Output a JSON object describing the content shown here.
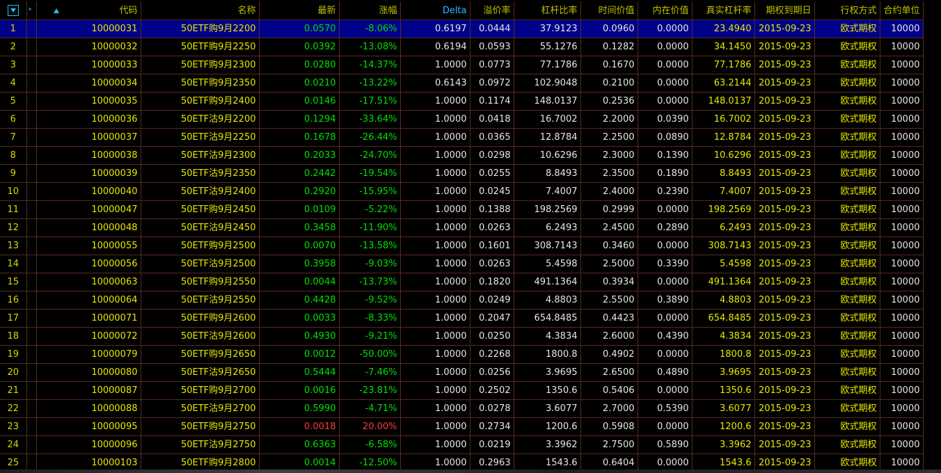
{
  "header": {
    "star": "*",
    "columns": [
      "代码",
      "名称",
      "最新",
      "涨幅",
      "Delta",
      "溢价率",
      "杠杆比率",
      "时间价值",
      "内在价值",
      "真实杠杆率",
      "期权到期日",
      "行权方式",
      "合约单位"
    ]
  },
  "rows": [
    {
      "no": "1",
      "code": "10000031",
      "name": "50ETF购9月2200",
      "last": "0.0570",
      "chg": "-8.06%",
      "delta": "0.6197",
      "prem": "0.0444",
      "lev": "37.9123",
      "tv": "0.0960",
      "iv": "0.0000",
      "real": "23.4940",
      "exp": "2015-09-23",
      "style": "欧式期权",
      "unit": "10000",
      "selected": true
    },
    {
      "no": "2",
      "code": "10000032",
      "name": "50ETF购9月2250",
      "last": "0.0392",
      "chg": "-13.08%",
      "delta": "0.6194",
      "prem": "0.0593",
      "lev": "55.1276",
      "tv": "0.1282",
      "iv": "0.0000",
      "real": "34.1450",
      "exp": "2015-09-23",
      "style": "欧式期权",
      "unit": "10000"
    },
    {
      "no": "3",
      "code": "10000033",
      "name": "50ETF购9月2300",
      "last": "0.0280",
      "chg": "-14.37%",
      "delta": "1.0000",
      "prem": "0.0773",
      "lev": "77.1786",
      "tv": "0.1670",
      "iv": "0.0000",
      "real": "77.1786",
      "exp": "2015-09-23",
      "style": "欧式期权",
      "unit": "10000"
    },
    {
      "no": "4",
      "code": "10000034",
      "name": "50ETF购9月2350",
      "last": "0.0210",
      "chg": "-13.22%",
      "delta": "0.6143",
      "prem": "0.0972",
      "lev": "102.9048",
      "tv": "0.2100",
      "iv": "0.0000",
      "real": "63.2144",
      "exp": "2015-09-23",
      "style": "欧式期权",
      "unit": "10000"
    },
    {
      "no": "5",
      "code": "10000035",
      "name": "50ETF购9月2400",
      "last": "0.0146",
      "chg": "-17.51%",
      "delta": "1.0000",
      "prem": "0.1174",
      "lev": "148.0137",
      "tv": "0.2536",
      "iv": "0.0000",
      "real": "148.0137",
      "exp": "2015-09-23",
      "style": "欧式期权",
      "unit": "10000"
    },
    {
      "no": "6",
      "code": "10000036",
      "name": "50ETF沽9月2200",
      "last": "0.1294",
      "chg": "-33.64%",
      "delta": "1.0000",
      "prem": "0.0418",
      "lev": "16.7002",
      "tv": "2.2000",
      "iv": "0.0390",
      "real": "16.7002",
      "exp": "2015-09-23",
      "style": "欧式期权",
      "unit": "10000"
    },
    {
      "no": "7",
      "code": "10000037",
      "name": "50ETF沽9月2250",
      "last": "0.1678",
      "chg": "-26.44%",
      "delta": "1.0000",
      "prem": "0.0365",
      "lev": "12.8784",
      "tv": "2.2500",
      "iv": "0.0890",
      "real": "12.8784",
      "exp": "2015-09-23",
      "style": "欧式期权",
      "unit": "10000"
    },
    {
      "no": "8",
      "code": "10000038",
      "name": "50ETF沽9月2300",
      "last": "0.2033",
      "chg": "-24.70%",
      "delta": "1.0000",
      "prem": "0.0298",
      "lev": "10.6296",
      "tv": "2.3000",
      "iv": "0.1390",
      "real": "10.6296",
      "exp": "2015-09-23",
      "style": "欧式期权",
      "unit": "10000"
    },
    {
      "no": "9",
      "code": "10000039",
      "name": "50ETF沽9月2350",
      "last": "0.2442",
      "chg": "-19.54%",
      "delta": "1.0000",
      "prem": "0.0255",
      "lev": "8.8493",
      "tv": "2.3500",
      "iv": "0.1890",
      "real": "8.8493",
      "exp": "2015-09-23",
      "style": "欧式期权",
      "unit": "10000"
    },
    {
      "no": "10",
      "code": "10000040",
      "name": "50ETF沽9月2400",
      "last": "0.2920",
      "chg": "-15.95%",
      "delta": "1.0000",
      "prem": "0.0245",
      "lev": "7.4007",
      "tv": "2.4000",
      "iv": "0.2390",
      "real": "7.4007",
      "exp": "2015-09-23",
      "style": "欧式期权",
      "unit": "10000"
    },
    {
      "no": "11",
      "code": "10000047",
      "name": "50ETF购9月2450",
      "last": "0.0109",
      "chg": "-5.22%",
      "delta": "1.0000",
      "prem": "0.1388",
      "lev": "198.2569",
      "tv": "0.2999",
      "iv": "0.0000",
      "real": "198.2569",
      "exp": "2015-09-23",
      "style": "欧式期权",
      "unit": "10000"
    },
    {
      "no": "12",
      "code": "10000048",
      "name": "50ETF沽9月2450",
      "last": "0.3458",
      "chg": "-11.90%",
      "delta": "1.0000",
      "prem": "0.0263",
      "lev": "6.2493",
      "tv": "2.4500",
      "iv": "0.2890",
      "real": "6.2493",
      "exp": "2015-09-23",
      "style": "欧式期权",
      "unit": "10000"
    },
    {
      "no": "13",
      "code": "10000055",
      "name": "50ETF购9月2500",
      "last": "0.0070",
      "chg": "-13.58%",
      "delta": "1.0000",
      "prem": "0.1601",
      "lev": "308.7143",
      "tv": "0.3460",
      "iv": "0.0000",
      "real": "308.7143",
      "exp": "2015-09-23",
      "style": "欧式期权",
      "unit": "10000"
    },
    {
      "no": "14",
      "code": "10000056",
      "name": "50ETF沽9月2500",
      "last": "0.3958",
      "chg": "-9.03%",
      "delta": "1.0000",
      "prem": "0.0263",
      "lev": "5.4598",
      "tv": "2.5000",
      "iv": "0.3390",
      "real": "5.4598",
      "exp": "2015-09-23",
      "style": "欧式期权",
      "unit": "10000"
    },
    {
      "no": "15",
      "code": "10000063",
      "name": "50ETF购9月2550",
      "last": "0.0044",
      "chg": "-13.73%",
      "delta": "1.0000",
      "prem": "0.1820",
      "lev": "491.1364",
      "tv": "0.3934",
      "iv": "0.0000",
      "real": "491.1364",
      "exp": "2015-09-23",
      "style": "欧式期权",
      "unit": "10000"
    },
    {
      "no": "16",
      "code": "10000064",
      "name": "50ETF沽9月2550",
      "last": "0.4428",
      "chg": "-9.52%",
      "delta": "1.0000",
      "prem": "0.0249",
      "lev": "4.8803",
      "tv": "2.5500",
      "iv": "0.3890",
      "real": "4.8803",
      "exp": "2015-09-23",
      "style": "欧式期权",
      "unit": "10000"
    },
    {
      "no": "17",
      "code": "10000071",
      "name": "50ETF购9月2600",
      "last": "0.0033",
      "chg": "-8.33%",
      "delta": "1.0000",
      "prem": "0.2047",
      "lev": "654.8485",
      "tv": "0.4423",
      "iv": "0.0000",
      "real": "654.8485",
      "exp": "2015-09-23",
      "style": "欧式期权",
      "unit": "10000"
    },
    {
      "no": "18",
      "code": "10000072",
      "name": "50ETF沽9月2600",
      "last": "0.4930",
      "chg": "-9.21%",
      "delta": "1.0000",
      "prem": "0.0250",
      "lev": "4.3834",
      "tv": "2.6000",
      "iv": "0.4390",
      "real": "4.3834",
      "exp": "2015-09-23",
      "style": "欧式期权",
      "unit": "10000"
    },
    {
      "no": "19",
      "code": "10000079",
      "name": "50ETF购9月2650",
      "last": "0.0012",
      "chg": "-50.00%",
      "delta": "1.0000",
      "prem": "0.2268",
      "lev": "1800.8",
      "tv": "0.4902",
      "iv": "0.0000",
      "real": "1800.8",
      "exp": "2015-09-23",
      "style": "欧式期权",
      "unit": "10000"
    },
    {
      "no": "20",
      "code": "10000080",
      "name": "50ETF沽9月2650",
      "last": "0.5444",
      "chg": "-7.46%",
      "delta": "1.0000",
      "prem": "0.0256",
      "lev": "3.9695",
      "tv": "2.6500",
      "iv": "0.4890",
      "real": "3.9695",
      "exp": "2015-09-23",
      "style": "欧式期权",
      "unit": "10000"
    },
    {
      "no": "21",
      "code": "10000087",
      "name": "50ETF购9月2700",
      "last": "0.0016",
      "chg": "-23.81%",
      "delta": "1.0000",
      "prem": "0.2502",
      "lev": "1350.6",
      "tv": "0.5406",
      "iv": "0.0000",
      "real": "1350.6",
      "exp": "2015-09-23",
      "style": "欧式期权",
      "unit": "10000"
    },
    {
      "no": "22",
      "code": "10000088",
      "name": "50ETF沽9月2700",
      "last": "0.5990",
      "chg": "-4.71%",
      "delta": "1.0000",
      "prem": "0.0278",
      "lev": "3.6077",
      "tv": "2.7000",
      "iv": "0.5390",
      "real": "3.6077",
      "exp": "2015-09-23",
      "style": "欧式期权",
      "unit": "10000"
    },
    {
      "no": "23",
      "code": "10000095",
      "name": "50ETF购9月2750",
      "last": "0.0018",
      "chg": "20.00%",
      "delta": "1.0000",
      "prem": "0.2734",
      "lev": "1200.6",
      "tv": "0.5908",
      "iv": "0.0000",
      "real": "1200.6",
      "exp": "2015-09-23",
      "style": "欧式期权",
      "unit": "10000",
      "up": true
    },
    {
      "no": "24",
      "code": "10000096",
      "name": "50ETF沽9月2750",
      "last": "0.6363",
      "chg": "-6.58%",
      "delta": "1.0000",
      "prem": "0.0219",
      "lev": "3.3962",
      "tv": "2.7500",
      "iv": "0.5890",
      "real": "3.3962",
      "exp": "2015-09-23",
      "style": "欧式期权",
      "unit": "10000"
    },
    {
      "no": "25",
      "code": "10000103",
      "name": "50ETF购9月2800",
      "last": "0.0014",
      "chg": "-12.50%",
      "delta": "1.0000",
      "prem": "0.2963",
      "lev": "1543.6",
      "tv": "0.6404",
      "iv": "0.0000",
      "real": "1543.6",
      "exp": "2015-09-23",
      "style": "欧式期权",
      "unit": "10000"
    }
  ]
}
